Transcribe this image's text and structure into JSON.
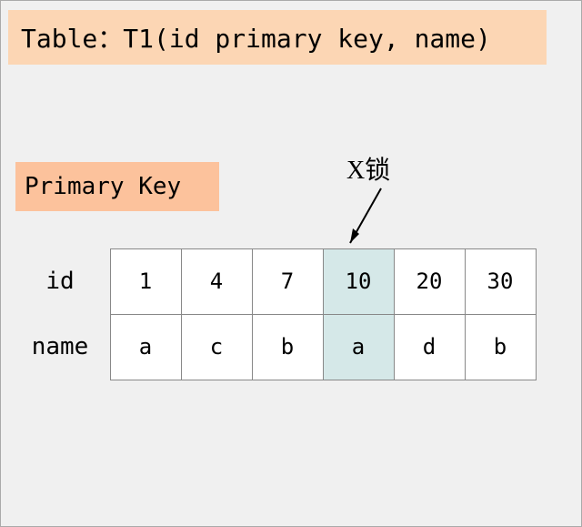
{
  "title": "Table：T1(id primary key, name)",
  "subtitle": "Primary Key",
  "lock_label": "X锁",
  "row_labels": {
    "id": "id",
    "name": "name"
  },
  "table": {
    "ids": [
      "1",
      "4",
      "7",
      "10",
      "20",
      "30"
    ],
    "names": [
      "a",
      "c",
      "b",
      "a",
      "d",
      "b"
    ]
  },
  "highlight_col_index": 3,
  "colors": {
    "title_bg": "#fcd6b4",
    "subtitle_bg": "#fcc29c",
    "highlight_bg": "#d5e8e8",
    "canvas_bg": "#f0f0f0"
  }
}
